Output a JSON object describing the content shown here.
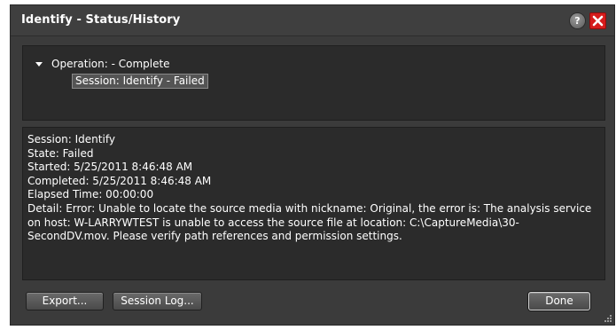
{
  "window": {
    "title": "Identify - Status/History",
    "help_label": "?"
  },
  "tree": {
    "operation_label": "Operation: - Complete",
    "session_label": "Session:  Identify - Failed",
    "expanded": true
  },
  "details": {
    "lines": [
      "Session: Identify",
      "State: Failed",
      "Started: 5/25/2011 8:46:48 AM",
      "Completed: 5/25/2011 8:46:48 AM",
      "Elapsed Time: 00:00:00"
    ],
    "detail_text": "Detail: Error: Unable to locate the source media with nickname: Original, the error is: The analysis service on host: W-LARRYWTEST is unable to access the source file at location: C:\\CaptureMedia\\30-SecondDV.mov.  Please verify path references and permission settings."
  },
  "buttons": {
    "export": "Export...",
    "session_log": "Session Log...",
    "done": "Done"
  },
  "colors": {
    "background": "#3b3b3b",
    "panel": "#2b2b2b",
    "close": "#d51c1c"
  }
}
